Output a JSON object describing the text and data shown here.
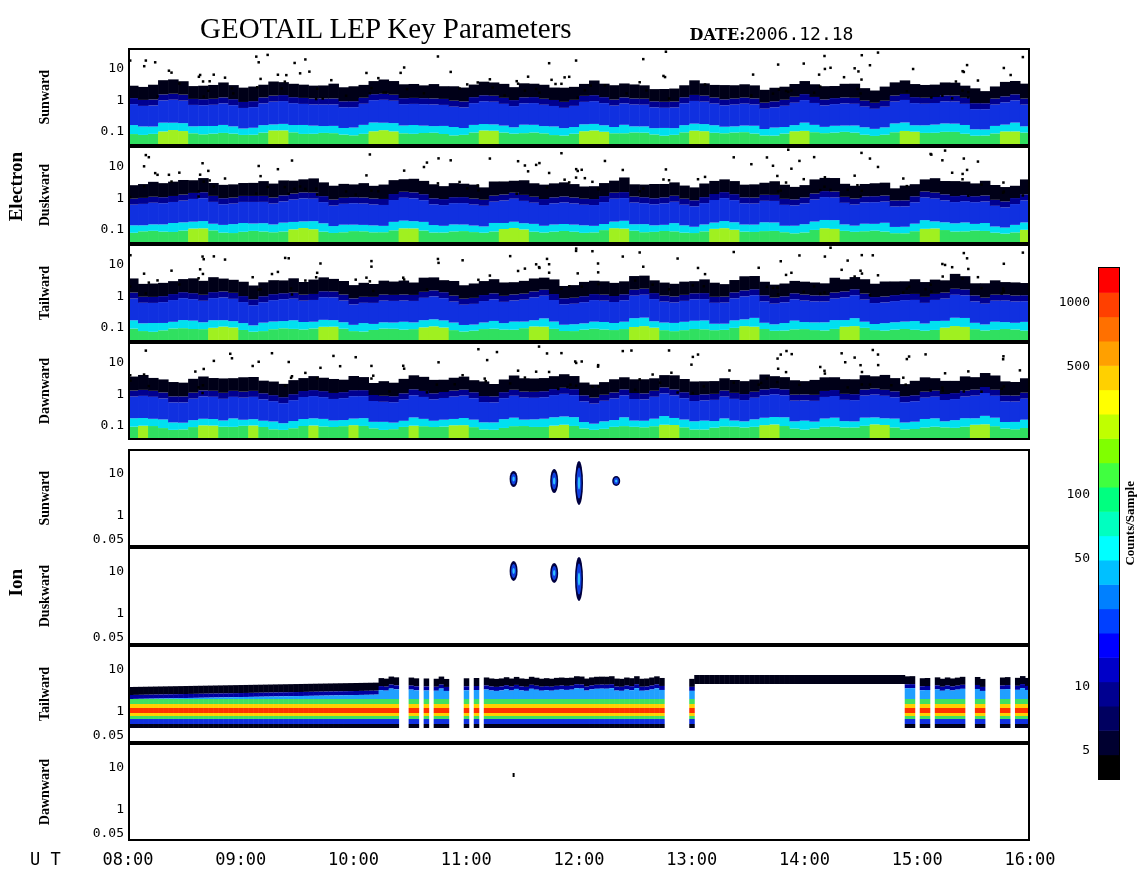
{
  "title": "GEOTAIL LEP Key Parameters",
  "date": {
    "label": "DATE:",
    "value": "2006.12.18"
  },
  "groups": [
    {
      "label": "Electron",
      "panels": [
        {
          "label": "Sunward",
          "kind": "electron",
          "yticks": [
            "10",
            "1",
            "0.1"
          ]
        },
        {
          "label": "Duskward",
          "kind": "electron",
          "yticks": [
            "10",
            "1",
            "0.1"
          ]
        },
        {
          "label": "Tailward",
          "kind": "electron",
          "yticks": [
            "10",
            "1",
            "0.1"
          ]
        },
        {
          "label": "Dawnward",
          "kind": "electron",
          "yticks": [
            "10",
            "1",
            "0.1"
          ]
        }
      ]
    },
    {
      "label": "Ion",
      "panels": [
        {
          "label": "Sunward",
          "kind": "sparse",
          "yticks": [
            "10",
            "1",
            "0.05"
          ]
        },
        {
          "label": "Duskward",
          "kind": "sparse",
          "yticks": [
            "10",
            "1",
            "0.05"
          ]
        },
        {
          "label": "Tailward",
          "kind": "dense",
          "yticks": [
            "10",
            "1",
            "0.05"
          ]
        },
        {
          "label": "Dawnward",
          "kind": "empty",
          "yticks": [
            "10",
            "1",
            "0.05"
          ]
        }
      ]
    }
  ],
  "xaxis": {
    "label": "U T",
    "ticks": [
      "08:00",
      "09:00",
      "10:00",
      "11:00",
      "12:00",
      "13:00",
      "14:00",
      "15:00",
      "16:00"
    ]
  },
  "colorbar": {
    "label": "Counts/Sample",
    "ticks": [
      "1000",
      "500",
      "100",
      "50",
      "10",
      "5"
    ]
  }
}
